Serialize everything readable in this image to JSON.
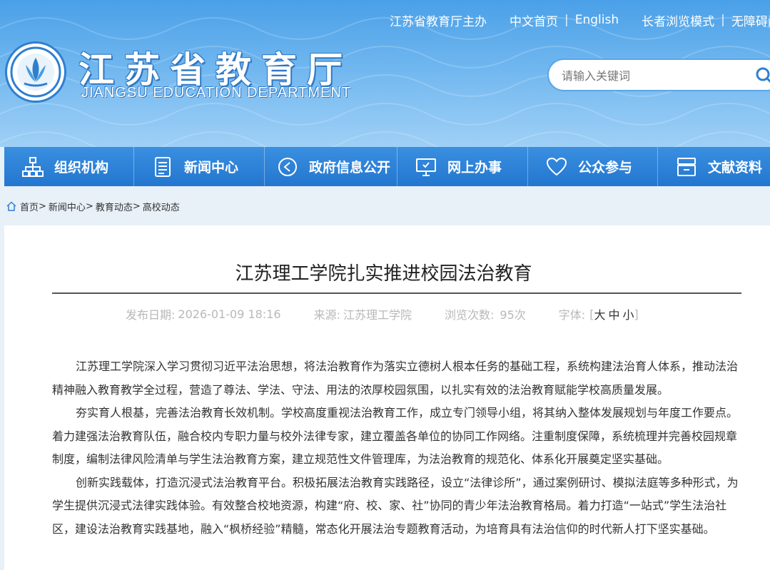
{
  "header": {
    "top_links": {
      "sponsor": "江苏省教育厅主办",
      "home_cn": "中文首页",
      "english": "English",
      "elder_mode": "长者浏览模式",
      "accessible": "无障碍阅"
    },
    "site_title_cn": "江苏省教育厅",
    "site_title_en": "JIANGSU EDUCATION DEPARTMENT",
    "search_placeholder": "请输入关键词",
    "colors": {
      "header_blue": "#4aa0e8",
      "nav_blue": "#2376cf"
    }
  },
  "nav": {
    "items": [
      {
        "label": "组织机构",
        "icon": "org-chart-icon"
      },
      {
        "label": "新闻中心",
        "icon": "document-icon"
      },
      {
        "label": "政府信息公开",
        "icon": "info-disclosure-icon"
      },
      {
        "label": "网上办事",
        "icon": "monitor-icon"
      },
      {
        "label": "公众参与",
        "icon": "heart-icon"
      },
      {
        "label": "文献资料",
        "icon": "archive-icon"
      }
    ]
  },
  "breadcrumb": {
    "home": "首页",
    "l1": "新闻中心",
    "l2": "教育动态",
    "l3": "高校动态",
    "sep": ">"
  },
  "article": {
    "title": "江苏理工学院扎实推进校园法治教育",
    "meta": {
      "date_label": "发布日期:",
      "date_value": "2026-01-09 18:16",
      "source_label": "来源:",
      "source_value": "江苏理工学院",
      "views_label": "浏览次数:",
      "views_value": "95次",
      "font_label": "字体:",
      "font_large": "大",
      "font_medium": "中",
      "font_small": "小"
    },
    "paragraphs": [
      "江苏理工学院深入学习贯彻习近平法治思想，将法治教育作为落实立德树人根本任务的基础工程，系统构建法治育人体系，推动法治精神融入教育教学全过程，营造了尊法、学法、守法、用法的浓厚校园氛围，以扎实有效的法治教育赋能学校高质量发展。",
      "夯实育人根基，完善法治教育长效机制。学校高度重视法治教育工作，成立专门领导小组，将其纳入整体发展规划与年度工作要点。着力建强法治教育队伍，融合校内专职力量与校外法律专家，建立覆盖各单位的协同工作网络。注重制度保障，系统梳理并完善校园规章制度，编制法律风险清单与学生法治教育方案，建立规范性文件管理库，为法治教育的规范化、体系化开展奠定坚实基础。",
      "创新实践载体，打造沉浸式法治教育平台。积极拓展法治教育实践路径，设立“法律诊所”，通过案例研讨、模拟法庭等多种形式，为学生提供沉浸式法律实践体验。有效整合校地资源，构建“府、校、家、社”协同的青少年法治教育格局。着力打造“一站式”学生法治社区，建设法治教育实践基地，融入“枫桥经验”精髓，常态化开展法治专题教育活动，为培育具有法治信仰的时代新人打下坚实基础。"
    ]
  }
}
